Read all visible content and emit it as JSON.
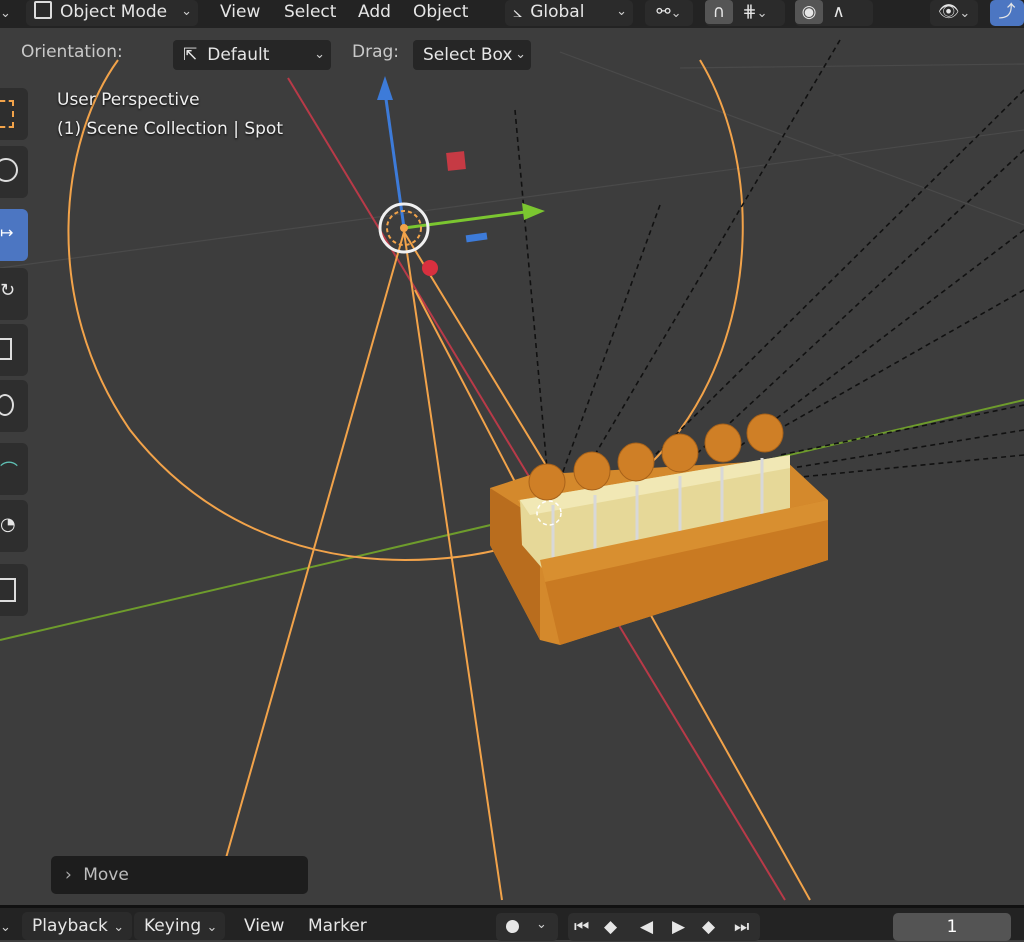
{
  "header": {
    "mode_label": "Object Mode",
    "menus": [
      "View",
      "Select",
      "Add",
      "Object"
    ],
    "transform_orientation": "Global"
  },
  "tool_settings": {
    "orientation_label": "Orientation:",
    "orientation_value": "Default",
    "drag_label": "Drag:",
    "drag_value": "Select Box"
  },
  "viewport": {
    "view_name": "User Perspective",
    "collection_info": "(1) Scene Collection | Spot"
  },
  "operator_panel": {
    "label": "Move"
  },
  "timeline": {
    "playback_label": "Playback",
    "keying_label": "Keying",
    "view_label": "View",
    "marker_label": "Marker",
    "current_frame": "1"
  },
  "colors": {
    "accent": "#4c76c2",
    "light_outline": "#f2a34a",
    "x_axis": "#b83a48",
    "y_axis": "#6e9c2c",
    "gizmo_z": "#3d7bd9",
    "gizmo_y": "#7bc630",
    "viewport_bg": "#3d3d3d"
  }
}
